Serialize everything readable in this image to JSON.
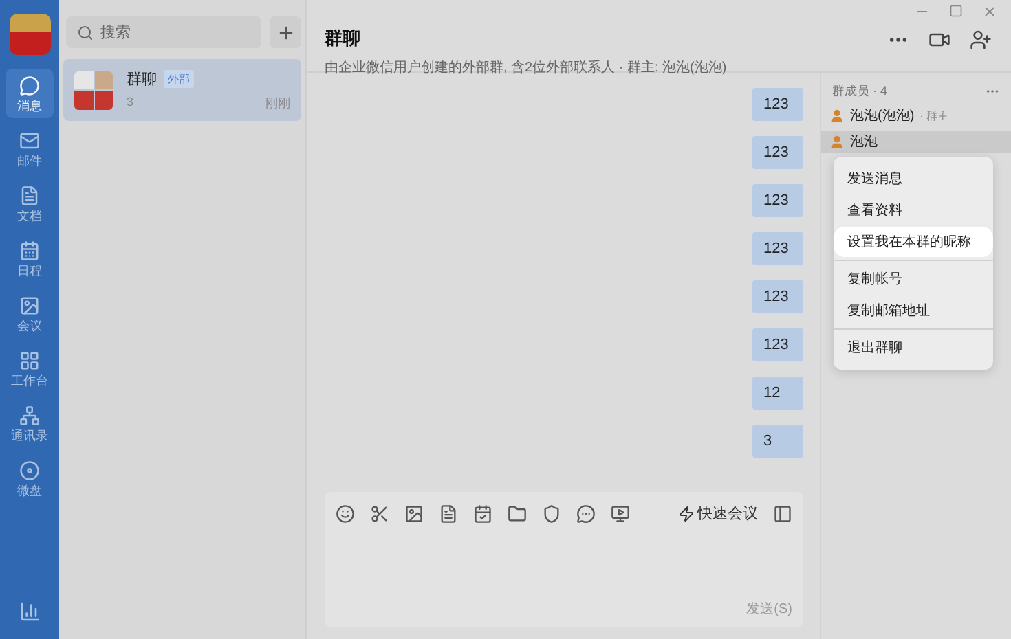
{
  "nav": {
    "items": [
      {
        "label": "消息",
        "selected": true
      },
      {
        "label": "邮件",
        "selected": false
      },
      {
        "label": "文档",
        "selected": false
      },
      {
        "label": "日程",
        "selected": false
      },
      {
        "label": "会议",
        "selected": false
      },
      {
        "label": "工作台",
        "selected": false
      },
      {
        "label": "通讯录",
        "selected": false
      },
      {
        "label": "微盘",
        "selected": false
      }
    ]
  },
  "search": {
    "placeholder": "搜索"
  },
  "conversations": [
    {
      "name": "群聊",
      "tag": "外部",
      "preview": "3",
      "time": "刚刚",
      "selected": true
    }
  ],
  "chat": {
    "title": "群聊",
    "subtitle": "由企业微信用户创建的外部群, 含2位外部联系人 · 群主: 泡泡(泡泡)",
    "messages": [
      "123",
      "123",
      "123",
      "123",
      "123",
      "123",
      "12",
      "3"
    ],
    "toolbar_button": "快速会议",
    "send": "发送(S)"
  },
  "members": {
    "title": "群成员 · 4",
    "list": [
      {
        "name": "泡泡(泡泡)",
        "role": "· 群主",
        "selected": false
      },
      {
        "name": "泡泡",
        "selected": true
      }
    ]
  },
  "context_menu": {
    "groups": [
      [
        {
          "label": "发送消息",
          "selected": false
        },
        {
          "label": "查看资料",
          "selected": false
        },
        {
          "label": "设置我在本群的昵称",
          "selected": true
        }
      ],
      [
        {
          "label": "复制帐号",
          "selected": false
        },
        {
          "label": "复制邮箱地址",
          "selected": false
        }
      ],
      [
        {
          "label": "退出群聊",
          "selected": false
        }
      ]
    ]
  }
}
